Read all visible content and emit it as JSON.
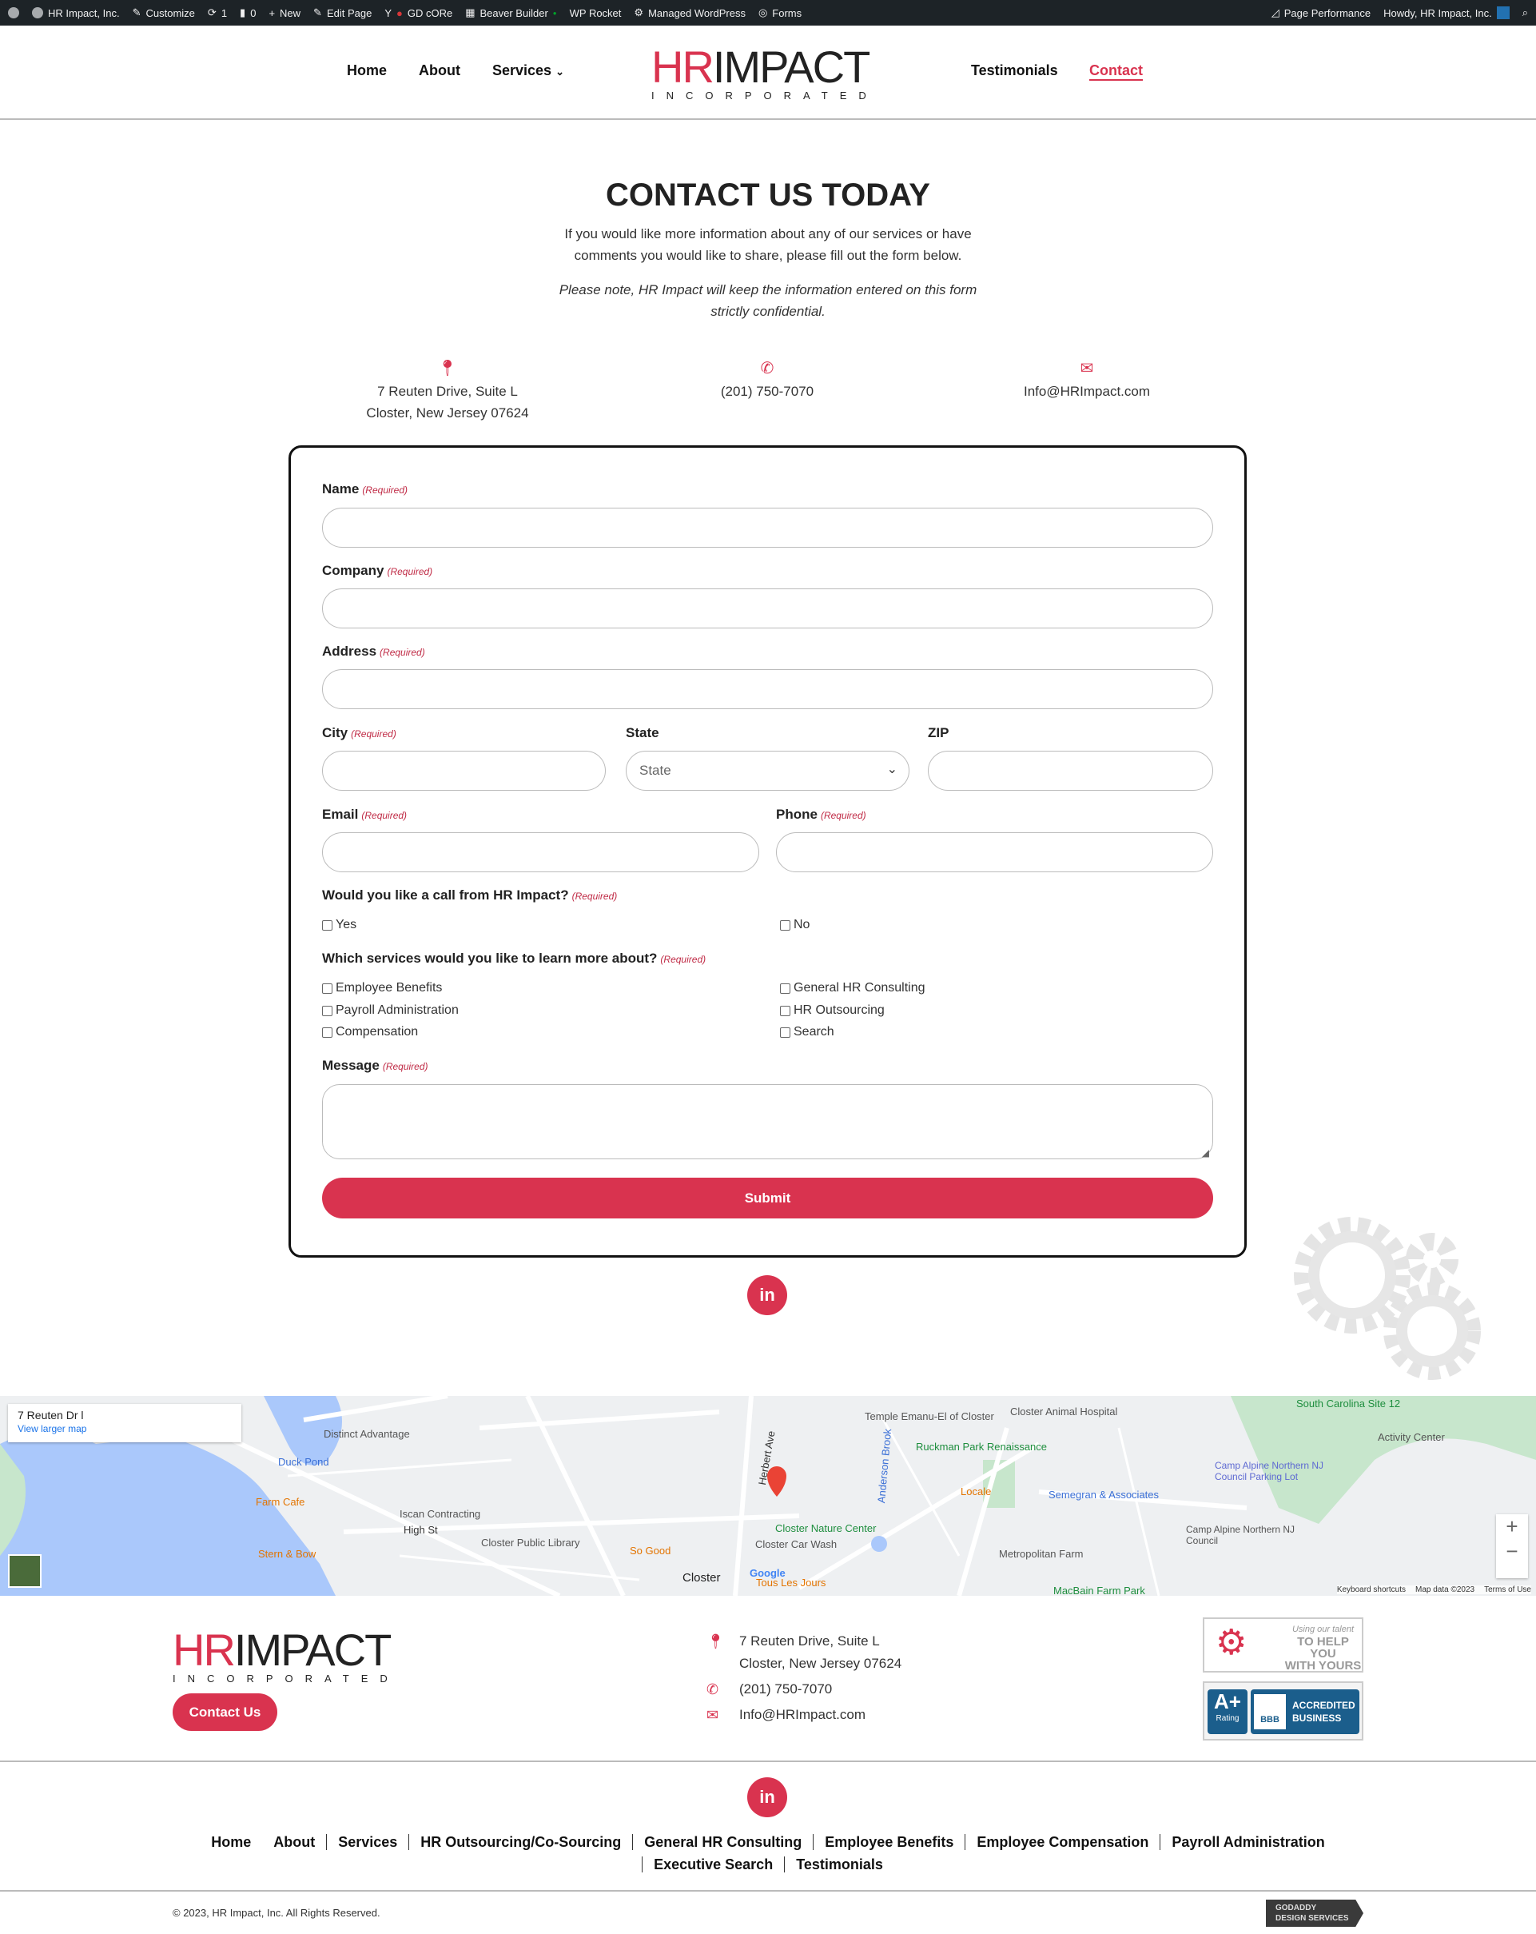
{
  "adminbar": {
    "items": [
      "HR Impact, Inc.",
      "Customize",
      "1",
      "0",
      "New",
      "Edit Page",
      "GD cORe",
      "Beaver Builder",
      "WP Rocket",
      "Managed WordPress",
      "Forms"
    ],
    "right": [
      "Page Performance",
      "Howdy, HR Impact, Inc."
    ]
  },
  "nav": {
    "home": "Home",
    "about": "About",
    "services": "Services",
    "testimonials": "Testimonials",
    "contact": "Contact",
    "active": "Contact"
  },
  "logo": {
    "hr": "HR",
    "impact": "IMPACT",
    "sub": "INCORPORATED"
  },
  "page": {
    "title": "CONTACT US TODAY",
    "intro1": "If you would like more information about any of our services or have",
    "intro2": "comments you would like to share, please fill out the form below.",
    "note1": "Please note, HR Impact will keep the information entered on this form",
    "note2": "strictly confidential."
  },
  "contact": {
    "address1": "7 Reuten Drive, Suite L",
    "address2": "Closter, New Jersey 07624",
    "phone": "(201) 750-7070",
    "email": "Info@HRImpact.com"
  },
  "form": {
    "required": "(Required)",
    "name": "Name",
    "company": "Company",
    "address": "Address",
    "city": "City",
    "state": "State",
    "state_placeholder": "State",
    "zip": "ZIP",
    "email": "Email",
    "phone": "Phone",
    "call_q": "Would you like a call from HR Impact?",
    "yes": "Yes",
    "no": "No",
    "services_q": "Which services would you like to learn more about?",
    "services": [
      "Employee Benefits",
      "Payroll Administration",
      "Compensation",
      "General HR Consulting",
      "HR Outsourcing",
      "Search"
    ],
    "message": "Message",
    "submit": "Submit"
  },
  "social": {
    "linkedin": "in"
  },
  "map": {
    "place": "7 Reuten Dr l",
    "larger": "View larger map",
    "labels": [
      "Distinct Advantage",
      "Duck Pond",
      "Farm Cafe",
      "Iscan Contracting",
      "High St",
      "Stern & Bow",
      "Closter Public Library",
      "So Good",
      "Closter",
      "Tous Les Jours",
      "Closter Car Wash",
      "Closter Nature Center",
      "Temple Emanu-El of Closter",
      "Closter Animal Hospital",
      "Ruckman Park Renaissance",
      "Locale",
      "Semegran & Associates",
      "Camp Alpine Northern NJ Council Parking Lot",
      "Camp Alpine Northern NJ Council",
      "Metropolitan Farm",
      "MacBain Farm Park",
      "South Carolina Site 12",
      "Activity Center",
      "Herbert Ave",
      "Anderson Brook"
    ],
    "footer": [
      "Keyboard shortcuts",
      "Map data ©2023",
      "Terms of Use"
    ],
    "brand": "Google"
  },
  "footer": {
    "contact_btn": "Contact Us",
    "badge1": [
      "Using our talent",
      "TO HELP YOU",
      "WITH YOURS"
    ],
    "badge2": [
      "A+",
      "Rating",
      "BBB",
      "ACCREDITED",
      "BUSINESS"
    ],
    "links": [
      "Home",
      "About",
      "Services",
      "HR Outsourcing/Co-Sourcing",
      "General HR Consulting",
      "Employee Benefits",
      "Employee Compensation",
      "Payroll Administration",
      "Executive Search",
      "Testimonials"
    ],
    "copyright": "© 2023, HR Impact, Inc. All Rights Reserved.",
    "godaddy": [
      "GODADDY",
      "DESIGN SERVICES"
    ]
  },
  "colors": {
    "accent": "#d9334f",
    "adminbar": "#1d2327"
  }
}
